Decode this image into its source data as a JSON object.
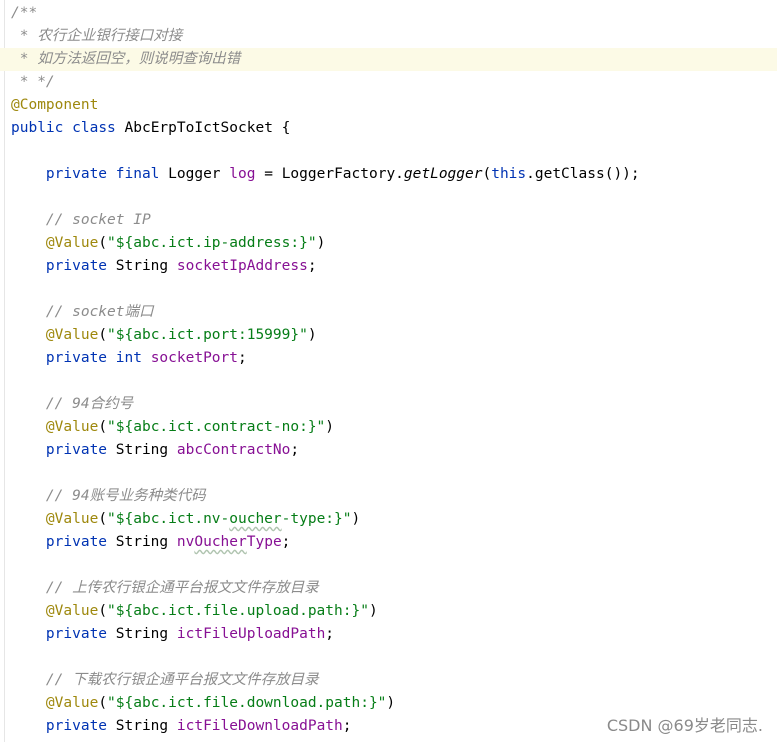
{
  "code": {
    "doc_open": "/**",
    "doc_line1": " * 农行企业银行接口对接",
    "doc_line2": " * 如方法返回空，则说明查询出错",
    "doc_close": " * */",
    "annotation_component": "@Component",
    "class_kw_public": "public",
    "class_kw_class": "class",
    "class_name": "AbcErpToIctSocket",
    "brace_open": "{",
    "logger": {
      "private": "private",
      "final": "final",
      "type": "Logger",
      "name": "log",
      "eq": "=",
      "factory": "LoggerFactory.",
      "method": "getLogger",
      "paren_open": "(",
      "this": "this",
      "rest": ".getClass());"
    },
    "fields": [
      {
        "comment": "// socket IP",
        "annotation": "@Value",
        "value": "\"${abc.ict.ip-address:}\"",
        "modifier": "private",
        "type": "String",
        "name": "socketIpAddress"
      },
      {
        "comment": "// socket端口",
        "annotation": "@Value",
        "value": "\"${abc.ict.port:15999}\"",
        "modifier": "private",
        "type": "int",
        "name": "socketPort"
      },
      {
        "comment": "// 94合约号",
        "annotation": "@Value",
        "value": "\"${abc.ict.contract-no:}\"",
        "modifier": "private",
        "type": "String",
        "name": "abcContractNo"
      },
      {
        "comment": "// 94账号业务种类代码",
        "annotation": "@Value",
        "value_prefix": "\"${abc.ict.nv-",
        "value_mid": "oucher",
        "value_suffix": "-type:}\"",
        "modifier": "private",
        "type": "String",
        "name_prefix": "nv",
        "name_mid": "Oucher",
        "name_suffix": "Type"
      },
      {
        "comment": "// 上传农行银企通平台报文文件存放目录",
        "annotation": "@Value",
        "value": "\"${abc.ict.file.upload.path:}\"",
        "modifier": "private",
        "type": "String",
        "name": "ictFileUploadPath"
      },
      {
        "comment": "// 下载农行银企通平台报文文件存放目录",
        "annotation": "@Value",
        "value": "\"${abc.ict.file.download.path:}\"",
        "modifier": "private",
        "type": "String",
        "name": "ictFileDownloadPath"
      }
    ]
  },
  "watermark": "CSDN @69岁老同志."
}
